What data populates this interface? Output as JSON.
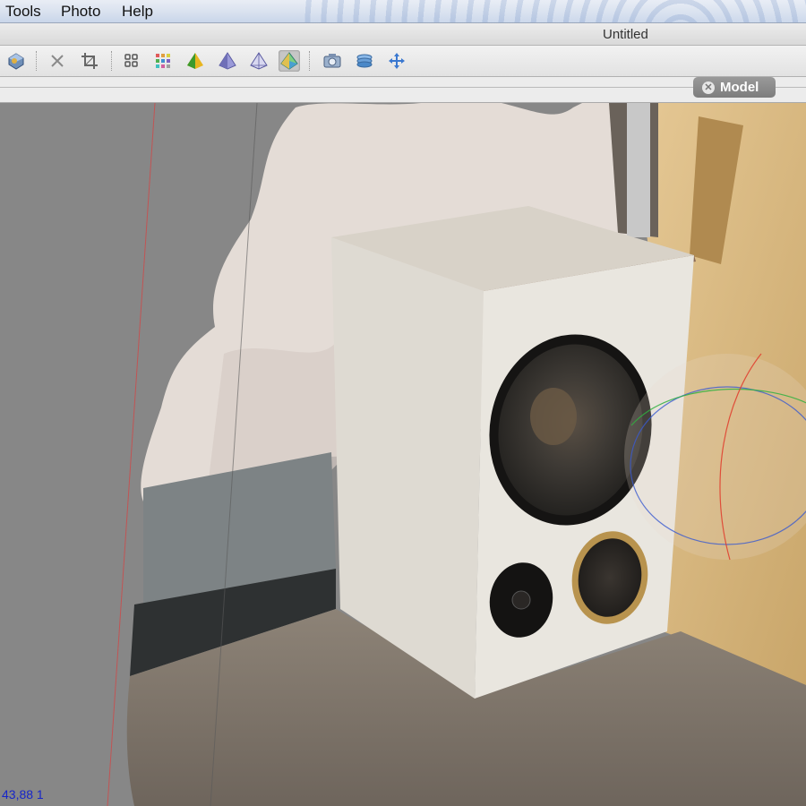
{
  "menu": {
    "items": [
      "Tools",
      "Photo",
      "Help"
    ]
  },
  "window": {
    "title": "Untitled"
  },
  "toolbar": {
    "icons": [
      "navigation-icon",
      "close-icon",
      "crop-icon",
      "grid-small-icon",
      "grid-color-icon",
      "shaded-model-icon",
      "solid-model-icon",
      "wireframe-model-icon",
      "textured-model-icon",
      "camera-icon",
      "layers-icon",
      "move-icon"
    ],
    "active": "textured-model-icon"
  },
  "tab": {
    "label": "Model"
  },
  "viewport": {
    "coordinate_readout": "43,88 1"
  },
  "colors": {
    "status_text": "#1726c9",
    "background": "#878787"
  }
}
